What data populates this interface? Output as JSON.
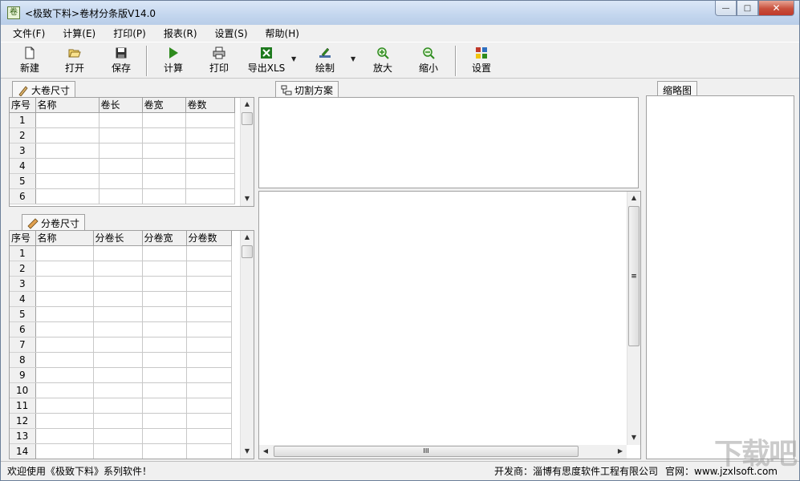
{
  "window": {
    "app_icon_glyph": "卷",
    "title": "<极致下料>卷材分条版V14.0",
    "min_glyph": "—",
    "max_glyph": "□",
    "close_glyph": "✕"
  },
  "menu": [
    {
      "label": "文件(F)"
    },
    {
      "label": "计算(E)"
    },
    {
      "label": "打印(P)"
    },
    {
      "label": "报表(R)"
    },
    {
      "label": "设置(S)"
    },
    {
      "label": "帮助(H)"
    }
  ],
  "toolbar": {
    "new": "新建",
    "open": "打开",
    "save": "保存",
    "calc": "计算",
    "print": "打印",
    "export_xls": "导出XLS",
    "draw": "绘制",
    "zoom_in": "放大",
    "zoom_out": "缩小",
    "settings": "设置",
    "drop_glyph": "▼"
  },
  "big_roll": {
    "tab": "大卷尺寸",
    "columns": [
      "序号",
      "名称",
      "卷长",
      "卷宽",
      "卷数"
    ],
    "rows": [
      "1",
      "2",
      "3",
      "4",
      "5",
      "6"
    ]
  },
  "split_roll": {
    "tab": "分卷尺寸",
    "columns": [
      "序号",
      "名称",
      "分卷长",
      "分卷宽",
      "分卷数"
    ],
    "rows": [
      "1",
      "2",
      "3",
      "4",
      "5",
      "6",
      "7",
      "8",
      "9",
      "10",
      "11",
      "12",
      "13",
      "14"
    ]
  },
  "cutting_plan": {
    "tab": "切割方案"
  },
  "thumbnail": {
    "tab": "缩略图"
  },
  "scroll": {
    "up": "▲",
    "down": "▼",
    "left": "◀",
    "right": "▶",
    "grip_v": "≡",
    "grip_h": "III"
  },
  "status": {
    "welcome": "欢迎使用《极致下料》系列软件！",
    "developer": "开发商：淄博有思度软件工程有限公司",
    "website": "官网：www.jzxlsoft.com"
  },
  "watermark": "下载吧",
  "colors": {
    "accent_green": "#2e8b1e",
    "close_red": "#c0392b"
  }
}
